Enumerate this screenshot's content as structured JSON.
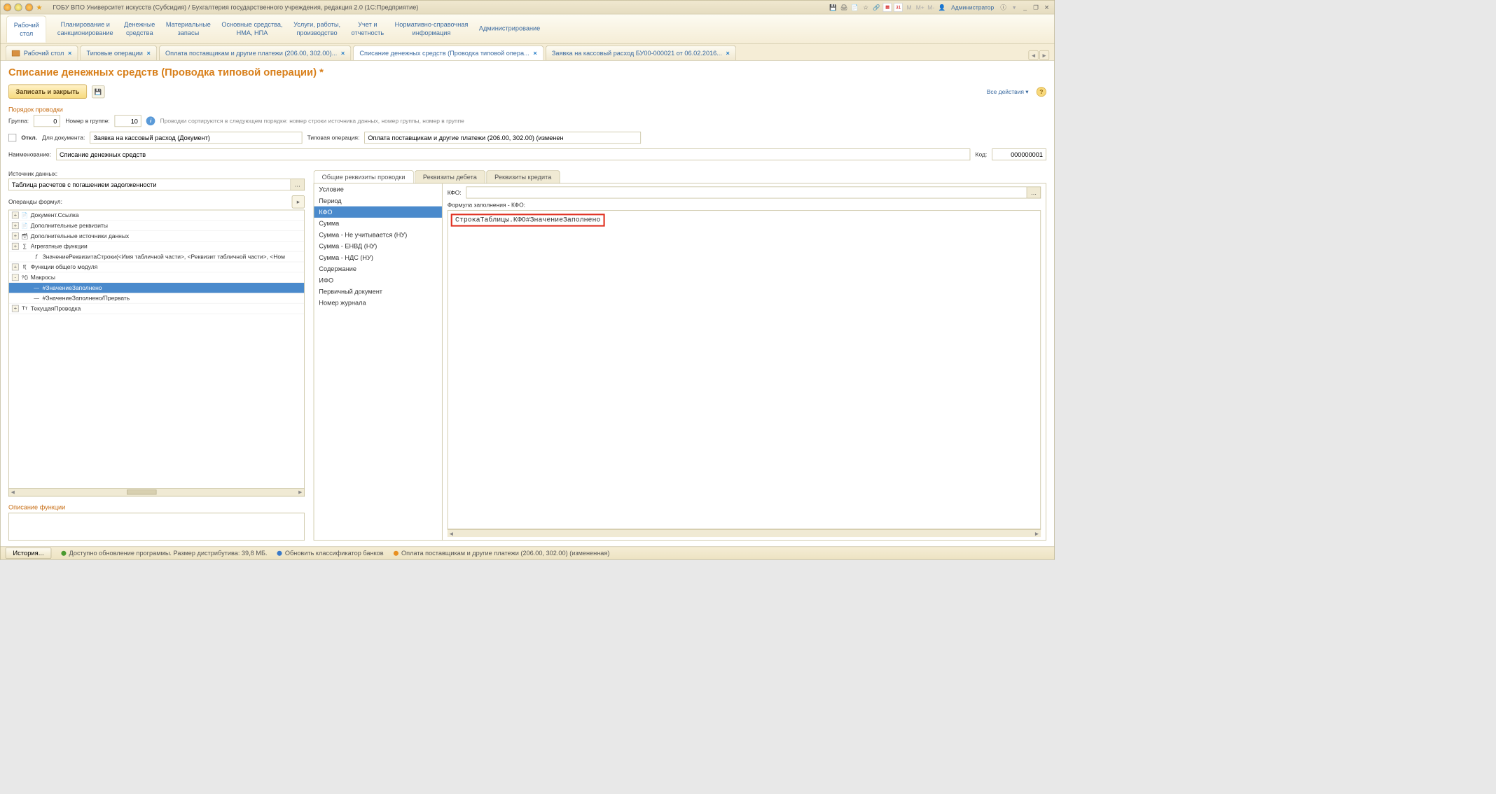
{
  "titlebar": {
    "title": "ГОБУ ВПО Университет искусств (Субсидия) / Бухгалтерия государственного учреждения, редакция 2.0  (1С:Предприятие)",
    "user": "Администратор"
  },
  "menubar": [
    "Рабочий\nстол",
    "Планирование и\nсанкционирование",
    "Денежные\nсредства",
    "Материальные\nзапасы",
    "Основные средства,\nНМА, НПА",
    "Услуги, работы,\nпроизводство",
    "Учет и\nотчетность",
    "Нормативно-справочная\nинформация",
    "Администрирование"
  ],
  "tabs": [
    {
      "label": "Рабочий стол",
      "icon": true
    },
    {
      "label": "Типовые операции"
    },
    {
      "label": "Оплата поставщикам и другие платежи (206.00, 302.00)..."
    },
    {
      "label": "Списание денежных средств (Проводка типовой опера...",
      "active": true
    },
    {
      "label": "Заявка на кассовый расход БУ00-000021 от 06.02.2016..."
    }
  ],
  "page": {
    "title": "Списание денежных средств (Проводка типовой операции) *",
    "save_close": "Записать и закрыть",
    "all_actions": "Все действия",
    "order_section": "Порядок проводки",
    "group_label": "Группа:",
    "group_value": "0",
    "num_label": "Номер в группе:",
    "num_value": "10",
    "sort_hint": "Проводки сортируются в следующем порядке: номер строки источника данных, номер группы,  номер в группе",
    "off_label": "Откл.",
    "for_doc_label": "Для документа:",
    "for_doc_value": "Заявка на кассовый расход (Документ)",
    "typical_label": "Типовая операция:",
    "typical_value": "Оплата поставщикам и другие платежи (206.00, 302.00) (изменен",
    "name_label": "Наименование:",
    "name_value": "Списание денежных средств",
    "code_label": "Код:",
    "code_value": "000000001",
    "src_label": "Источник данных:",
    "src_value": "Таблица расчетов с погашением задолженности",
    "operands_label": "Операнды формул:",
    "desc_label": "Описание функции"
  },
  "tree": [
    {
      "exp": "+",
      "icon": "doc",
      "label": "Документ.Ссылка"
    },
    {
      "exp": "+",
      "icon": "doc",
      "label": "Дополнительные реквизиты"
    },
    {
      "exp": "+",
      "icon": "db",
      "label": "Дополнительные источники данных"
    },
    {
      "exp": "+",
      "icon": "sum",
      "label": "Агрегатные функции"
    },
    {
      "exp": " ",
      "icon": "fx",
      "label": "ЗначениеРеквизитаСтроки(<Имя табличной части>, <Реквизит табличной части>, <Ном",
      "indent": 1
    },
    {
      "exp": "+",
      "icon": "mod",
      "label": "Функции общего модуля"
    },
    {
      "exp": "-",
      "icon": "mac",
      "label": "Макросы"
    },
    {
      "exp": " ",
      "icon": "dash",
      "label": "#ЗначениеЗаполнено",
      "indent": 1,
      "selected": true
    },
    {
      "exp": " ",
      "icon": "dash",
      "label": "#ЗначениеЗаполнено/Прервать",
      "indent": 1
    },
    {
      "exp": "+",
      "icon": "tr",
      "label": "ТекущаяПроводка"
    }
  ],
  "right": {
    "tabs": [
      "Общие реквизиты проводки",
      "Реквизиты дебета",
      "Реквизиты кредита"
    ],
    "attrs": [
      "Условие",
      "Период",
      "КФО",
      "Сумма",
      "Сумма - Не учитывается (НУ)",
      "Сумма - ЕНВД (НУ)",
      "Сумма - НДС (НУ)",
      "Содержание",
      "ИФО",
      "Первичный документ",
      "Номер журнала"
    ],
    "attr_selected": 2,
    "kfo_label": "КФО:",
    "kfo_value": "",
    "formula_label": "Формула заполнения - КФО:",
    "formula_value": "СтрокаТаблицы.КФО#ЗначениеЗаполнено"
  },
  "status": {
    "history": "История...",
    "s1": "Доступно обновление программы. Размер дистрибутива: 39,8 МБ.",
    "s2": "Обновить классификатор банков",
    "s3": "Оплата поставщикам и другие платежи (206.00, 302.00) (измененная)"
  }
}
